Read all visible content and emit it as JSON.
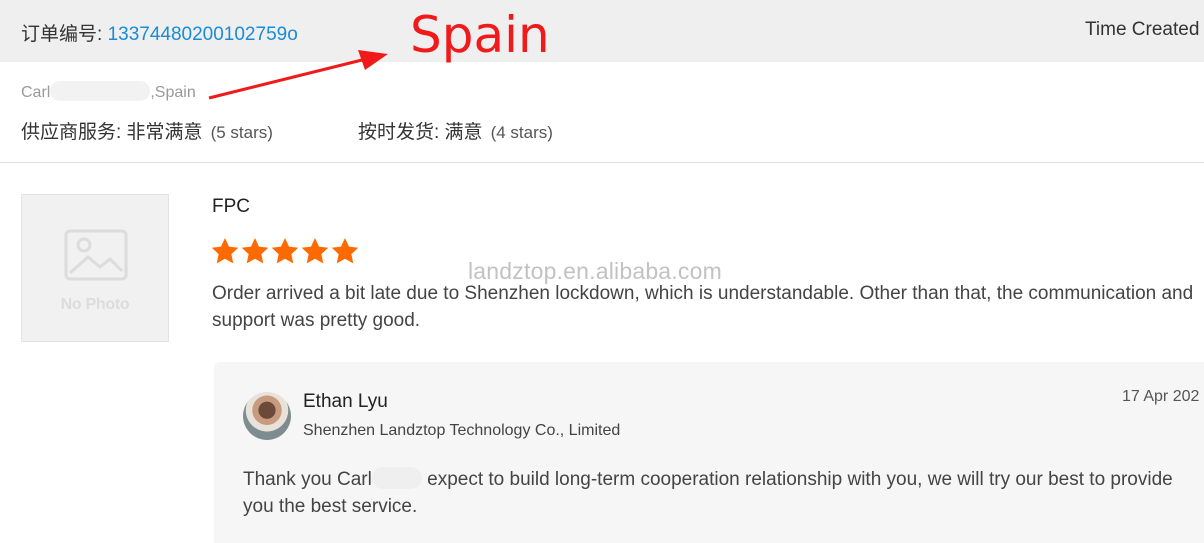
{
  "order": {
    "label": "订单编号: ",
    "number": "13374480200102759o",
    "time_created_label": "Time Created"
  },
  "annotation": {
    "text": "Spain",
    "color": "#f01a1a"
  },
  "buyer": {
    "name_prefix": "Carl",
    "country_suffix": ",Spain"
  },
  "ratings": [
    {
      "label": "供应商服务: 非常满意",
      "stars_text": "(5 stars)"
    },
    {
      "label": "按时发货: 满意",
      "stars_text": "(4 stars)"
    }
  ],
  "product": {
    "photo_placeholder": "No Photo",
    "name": "FPC",
    "star_rating": 5,
    "star_color": "#ff6a00",
    "review": "Order arrived a bit late due to Shenzhen lockdown, which is understandable. Other than that, the communication and support was pretty good."
  },
  "watermark": "landztop.en.alibaba.com",
  "reply": {
    "name": "Ethan Lyu",
    "company": "Shenzhen Landztop Technology Co., Limited",
    "date": "17 Apr 202",
    "text_prefix": "Thank you Carl",
    "text_suffix": " expect to build long-term cooperation relationship with you, we will try our best to provide you the best service."
  }
}
